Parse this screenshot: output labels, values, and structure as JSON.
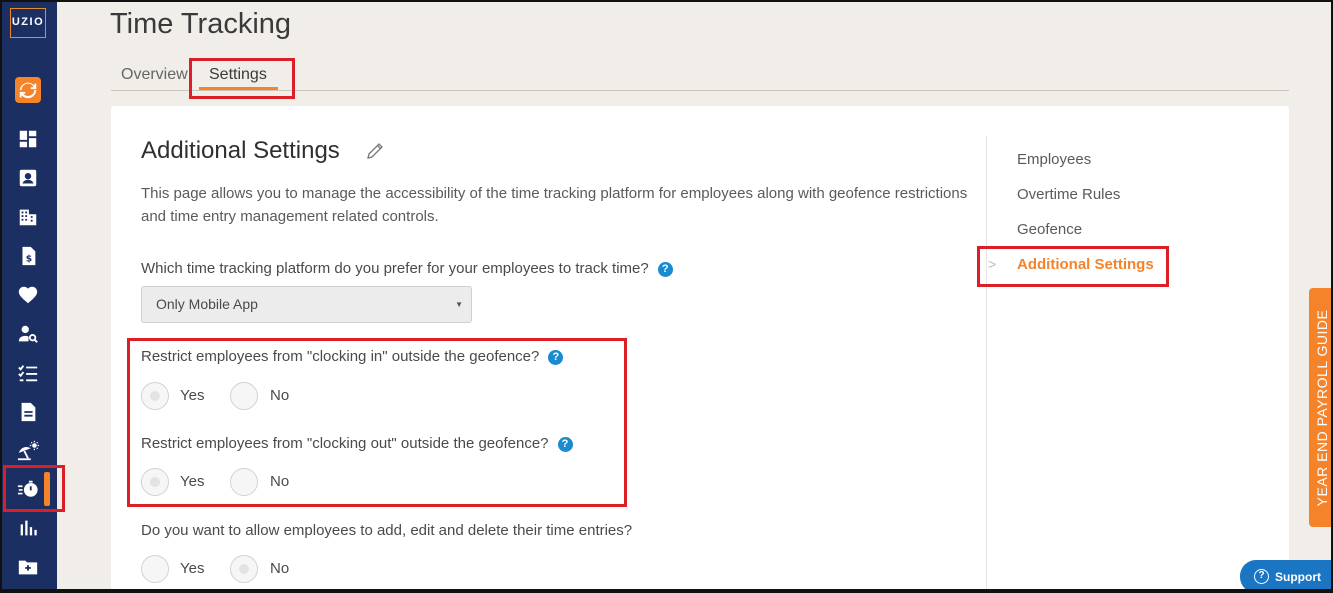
{
  "brand": {
    "logo_text": "UZIO",
    "accent_color": "#f4832a",
    "sidebar_color": "#1c2f63",
    "highlight_color": "#dc1f26",
    "help_color": "#1b8bd0"
  },
  "sidebar": {
    "items": [
      {
        "name": "refresh-icon"
      },
      {
        "name": "dashboard-icon"
      },
      {
        "name": "employee-card-icon"
      },
      {
        "name": "building-icon"
      },
      {
        "name": "payroll-document-icon"
      },
      {
        "name": "heart-icon"
      },
      {
        "name": "user-search-icon"
      },
      {
        "name": "checklist-icon"
      },
      {
        "name": "document-icon"
      },
      {
        "name": "beach-umbrella-icon"
      },
      {
        "name": "stopwatch-icon",
        "active": true
      },
      {
        "name": "bar-chart-icon"
      },
      {
        "name": "folder-add-icon"
      }
    ]
  },
  "header": {
    "title": "Time Tracking"
  },
  "tabs": [
    {
      "label": "Overview"
    },
    {
      "label": "Settings",
      "active": true
    }
  ],
  "main": {
    "title": "Additional Settings",
    "description": "This page allows you to manage the accessibility of the time tracking platform for employees along with geofence restrictions and time entry management related controls.",
    "platform_question": "Which time tracking platform do you prefer for your employees to track time?",
    "platform_value": "Only Mobile App",
    "q_clock_in": "Restrict employees from \"clocking in\" outside the geofence?",
    "q_clock_out": "Restrict employees from \"clocking out\" outside the geofence?",
    "q_time_entries": "Do you want to allow employees to add, edit and delete their time entries?",
    "yes_label": "Yes",
    "no_label": "No"
  },
  "side_nav": [
    {
      "label": "Employees"
    },
    {
      "label": "Overtime Rules"
    },
    {
      "label": "Geofence"
    },
    {
      "label": "Additional Settings",
      "active": true
    }
  ],
  "year_end_label": "YEAR END PAYROLL GUIDE",
  "support_label": "Support"
}
